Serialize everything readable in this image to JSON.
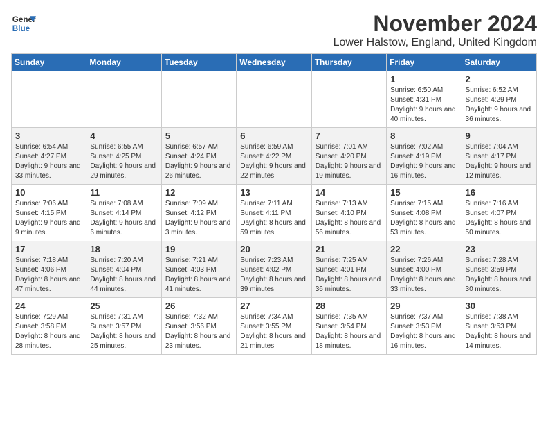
{
  "logo": {
    "line1": "General",
    "line2": "Blue"
  },
  "title": "November 2024",
  "location": "Lower Halstow, England, United Kingdom",
  "days_of_week": [
    "Sunday",
    "Monday",
    "Tuesday",
    "Wednesday",
    "Thursday",
    "Friday",
    "Saturday"
  ],
  "weeks": [
    [
      {
        "day": "",
        "info": ""
      },
      {
        "day": "",
        "info": ""
      },
      {
        "day": "",
        "info": ""
      },
      {
        "day": "",
        "info": ""
      },
      {
        "day": "",
        "info": ""
      },
      {
        "day": "1",
        "info": "Sunrise: 6:50 AM\nSunset: 4:31 PM\nDaylight: 9 hours and 40 minutes."
      },
      {
        "day": "2",
        "info": "Sunrise: 6:52 AM\nSunset: 4:29 PM\nDaylight: 9 hours and 36 minutes."
      }
    ],
    [
      {
        "day": "3",
        "info": "Sunrise: 6:54 AM\nSunset: 4:27 PM\nDaylight: 9 hours and 33 minutes."
      },
      {
        "day": "4",
        "info": "Sunrise: 6:55 AM\nSunset: 4:25 PM\nDaylight: 9 hours and 29 minutes."
      },
      {
        "day": "5",
        "info": "Sunrise: 6:57 AM\nSunset: 4:24 PM\nDaylight: 9 hours and 26 minutes."
      },
      {
        "day": "6",
        "info": "Sunrise: 6:59 AM\nSunset: 4:22 PM\nDaylight: 9 hours and 22 minutes."
      },
      {
        "day": "7",
        "info": "Sunrise: 7:01 AM\nSunset: 4:20 PM\nDaylight: 9 hours and 19 minutes."
      },
      {
        "day": "8",
        "info": "Sunrise: 7:02 AM\nSunset: 4:19 PM\nDaylight: 9 hours and 16 minutes."
      },
      {
        "day": "9",
        "info": "Sunrise: 7:04 AM\nSunset: 4:17 PM\nDaylight: 9 hours and 12 minutes."
      }
    ],
    [
      {
        "day": "10",
        "info": "Sunrise: 7:06 AM\nSunset: 4:15 PM\nDaylight: 9 hours and 9 minutes."
      },
      {
        "day": "11",
        "info": "Sunrise: 7:08 AM\nSunset: 4:14 PM\nDaylight: 9 hours and 6 minutes."
      },
      {
        "day": "12",
        "info": "Sunrise: 7:09 AM\nSunset: 4:12 PM\nDaylight: 9 hours and 3 minutes."
      },
      {
        "day": "13",
        "info": "Sunrise: 7:11 AM\nSunset: 4:11 PM\nDaylight: 8 hours and 59 minutes."
      },
      {
        "day": "14",
        "info": "Sunrise: 7:13 AM\nSunset: 4:10 PM\nDaylight: 8 hours and 56 minutes."
      },
      {
        "day": "15",
        "info": "Sunrise: 7:15 AM\nSunset: 4:08 PM\nDaylight: 8 hours and 53 minutes."
      },
      {
        "day": "16",
        "info": "Sunrise: 7:16 AM\nSunset: 4:07 PM\nDaylight: 8 hours and 50 minutes."
      }
    ],
    [
      {
        "day": "17",
        "info": "Sunrise: 7:18 AM\nSunset: 4:06 PM\nDaylight: 8 hours and 47 minutes."
      },
      {
        "day": "18",
        "info": "Sunrise: 7:20 AM\nSunset: 4:04 PM\nDaylight: 8 hours and 44 minutes."
      },
      {
        "day": "19",
        "info": "Sunrise: 7:21 AM\nSunset: 4:03 PM\nDaylight: 8 hours and 41 minutes."
      },
      {
        "day": "20",
        "info": "Sunrise: 7:23 AM\nSunset: 4:02 PM\nDaylight: 8 hours and 39 minutes."
      },
      {
        "day": "21",
        "info": "Sunrise: 7:25 AM\nSunset: 4:01 PM\nDaylight: 8 hours and 36 minutes."
      },
      {
        "day": "22",
        "info": "Sunrise: 7:26 AM\nSunset: 4:00 PM\nDaylight: 8 hours and 33 minutes."
      },
      {
        "day": "23",
        "info": "Sunrise: 7:28 AM\nSunset: 3:59 PM\nDaylight: 8 hours and 30 minutes."
      }
    ],
    [
      {
        "day": "24",
        "info": "Sunrise: 7:29 AM\nSunset: 3:58 PM\nDaylight: 8 hours and 28 minutes."
      },
      {
        "day": "25",
        "info": "Sunrise: 7:31 AM\nSunset: 3:57 PM\nDaylight: 8 hours and 25 minutes."
      },
      {
        "day": "26",
        "info": "Sunrise: 7:32 AM\nSunset: 3:56 PM\nDaylight: 8 hours and 23 minutes."
      },
      {
        "day": "27",
        "info": "Sunrise: 7:34 AM\nSunset: 3:55 PM\nDaylight: 8 hours and 21 minutes."
      },
      {
        "day": "28",
        "info": "Sunrise: 7:35 AM\nSunset: 3:54 PM\nDaylight: 8 hours and 18 minutes."
      },
      {
        "day": "29",
        "info": "Sunrise: 7:37 AM\nSunset: 3:53 PM\nDaylight: 8 hours and 16 minutes."
      },
      {
        "day": "30",
        "info": "Sunrise: 7:38 AM\nSunset: 3:53 PM\nDaylight: 8 hours and 14 minutes."
      }
    ]
  ]
}
